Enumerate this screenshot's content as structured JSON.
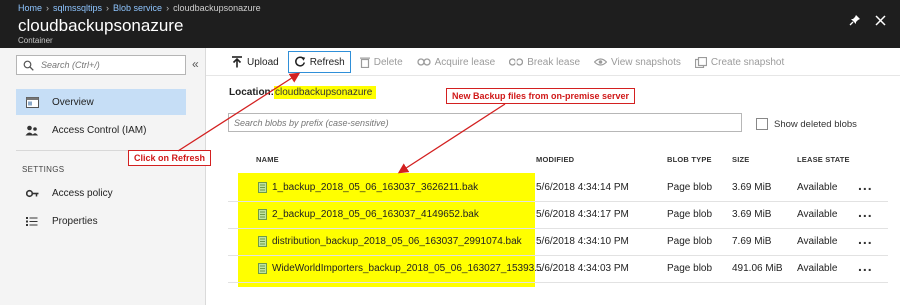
{
  "header": {
    "breadcrumbs": [
      "Home",
      "sqlmssqltips",
      "Blob service",
      "cloudbackupsonazure"
    ],
    "title": "cloudbackupsonazure",
    "subtitle": "Container",
    "pin_icon": "pin-icon",
    "close_icon": "close-icon"
  },
  "sidebar": {
    "search_placeholder": "Search (Ctrl+/)",
    "collapse_glyph": "«",
    "items": [
      {
        "label": "Overview",
        "icon": "overview-icon",
        "active": true
      },
      {
        "label": "Access Control (IAM)",
        "icon": "iam-icon",
        "active": false
      }
    ],
    "section_label": "SETTINGS",
    "settings_items": [
      {
        "label": "Access policy",
        "icon": "key-icon"
      },
      {
        "label": "Properties",
        "icon": "properties-icon"
      }
    ]
  },
  "toolbar": {
    "upload": "Upload",
    "refresh": "Refresh",
    "delete": "Delete",
    "acquire_lease": "Acquire lease",
    "break_lease": "Break lease",
    "view_snapshots": "View snapshots",
    "create_snapshot": "Create snapshot"
  },
  "location": {
    "label": "Location:",
    "value": "cloudbackupsonazure"
  },
  "blob_search": {
    "placeholder": "Search blobs by prefix (case-sensitive)",
    "show_deleted_label": "Show deleted blobs"
  },
  "table": {
    "columns": [
      "NAME",
      "MODIFIED",
      "BLOB TYPE",
      "SIZE",
      "LEASE STATE"
    ],
    "rows": [
      {
        "name": "1_backup_2018_05_06_163037_3626211.bak",
        "modified": "5/6/2018 4:34:14 PM",
        "type": "Page blob",
        "size": "3.69 MiB",
        "lease": "Available"
      },
      {
        "name": "2_backup_2018_05_06_163037_4149652.bak",
        "modified": "5/6/2018 4:34:17 PM",
        "type": "Page blob",
        "size": "3.69 MiB",
        "lease": "Available"
      },
      {
        "name": "distribution_backup_2018_05_06_163037_2991074.bak",
        "modified": "5/6/2018 4:34:10 PM",
        "type": "Page blob",
        "size": "7.69 MiB",
        "lease": "Available"
      },
      {
        "name": "WideWorldImporters_backup_2018_05_06_163027_15393...",
        "modified": "5/6/2018 4:34:03 PM",
        "type": "Page blob",
        "size": "491.06 MiB",
        "lease": "Available"
      }
    ],
    "more_glyph": "..."
  },
  "annotations": {
    "click_refresh": "Click on Refresh",
    "new_backups": "New Backup files from on-premise server"
  },
  "colors": {
    "highlight": "#ffff00",
    "annotation_red": "#d32020",
    "header_bg": "#1e1e1e",
    "active_nav": "#c6def6",
    "link_blue": "#8ec5ff"
  }
}
